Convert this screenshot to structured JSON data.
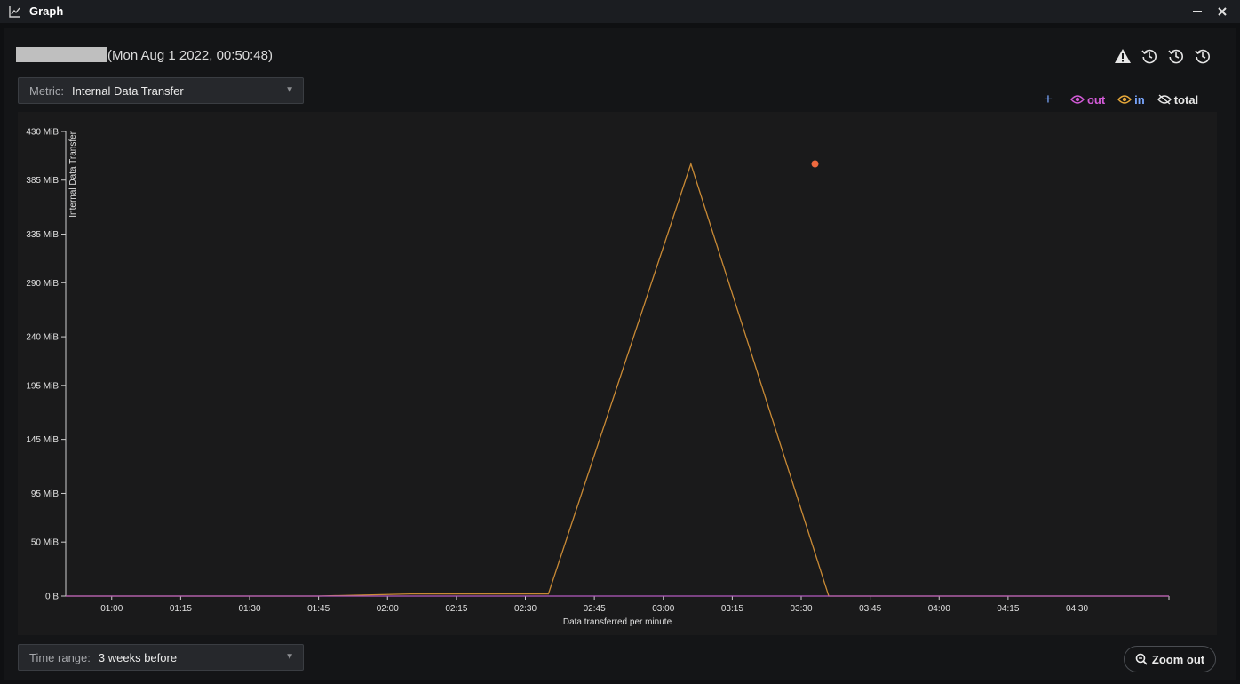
{
  "window": {
    "title": "Graph",
    "minimize_icon": "minimize-icon",
    "close_icon": "close-icon"
  },
  "heading": {
    "timestamp": "(Mon Aug 1 2022, 00:50:48)"
  },
  "toolbar_icons": [
    "warning-icon",
    "history-icon",
    "history-icon",
    "history-icon"
  ],
  "metric": {
    "label": "Metric:",
    "value": "Internal Data Transfer"
  },
  "legend": {
    "add_icon": "plus-icon",
    "items": [
      {
        "label": "out",
        "color": "#d35bd8",
        "icon": "eye-icon"
      },
      {
        "label": "in",
        "color": "#e8a93a",
        "icon": "eye-icon"
      },
      {
        "label": "total",
        "color": "#e6e6e6",
        "icon": "eye-off-icon"
      }
    ]
  },
  "time_range": {
    "label": "Time range:",
    "value": "3 weeks before"
  },
  "zoom": {
    "label": "Zoom out",
    "icon": "zoom-out-icon"
  },
  "colors": {
    "in_line": "#c98a35",
    "out_line": "#b35bc0",
    "marker": "#f06a3f",
    "axis": "#cfcfcf"
  },
  "chart_data": {
    "type": "line",
    "xlabel": "Data transferred per minute",
    "ylabel": "Internal Data Transfer",
    "y_ticks": [
      "430 MiB",
      "385 MiB",
      "335 MiB",
      "290 MiB",
      "240 MiB",
      "195 MiB",
      "145 MiB",
      "95 MiB",
      "50 MiB",
      "0 B"
    ],
    "y_tick_values": [
      430,
      385,
      335,
      290,
      240,
      195,
      145,
      95,
      50,
      0
    ],
    "x_ticks": [
      "01:00",
      "01:15",
      "01:30",
      "01:45",
      "02:00",
      "02:15",
      "02:30",
      "02:45",
      "03:00",
      "03:15",
      "03:30",
      "03:45",
      "04:00",
      "04:15",
      "04:30"
    ],
    "xlim": [
      "00:50",
      "04:50"
    ],
    "ylim": [
      0,
      430
    ],
    "grid": false,
    "series": [
      {
        "name": "in",
        "x": [
          "00:50",
          "01:45",
          "02:05",
          "02:35",
          "03:06",
          "03:36",
          "04:50"
        ],
        "values": [
          0,
          0,
          2,
          2,
          400,
          0,
          0
        ]
      },
      {
        "name": "out",
        "x": [
          "00:50",
          "04:50"
        ],
        "values": [
          0,
          0
        ]
      }
    ],
    "annotations": [
      {
        "type": "marker",
        "x": "03:33",
        "y": 400
      }
    ]
  }
}
